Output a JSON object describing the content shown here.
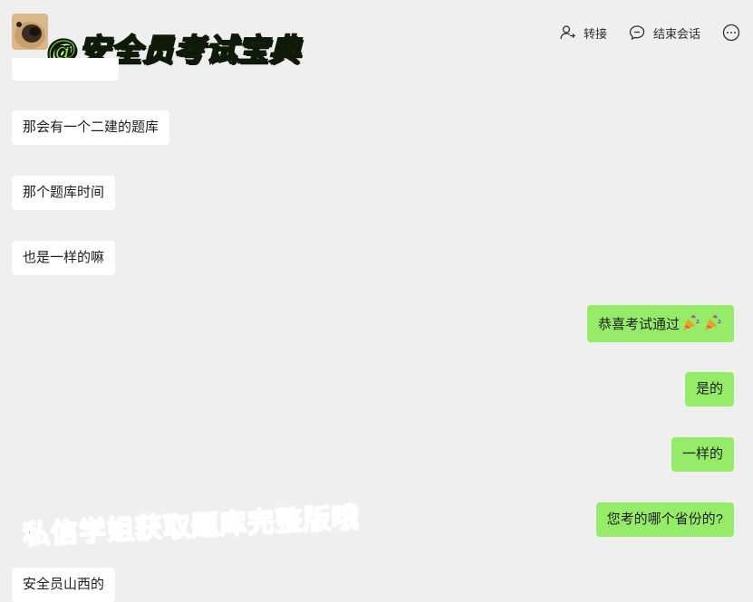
{
  "header": {
    "watermark_title": "@安全员考试宝典",
    "transfer_label": "转接",
    "end_session_label": "结束会话"
  },
  "messages": [
    {
      "side": "in",
      "text": "那会有一个二建的题库"
    },
    {
      "side": "in",
      "text": "那个题库时间"
    },
    {
      "side": "in",
      "text": "也是一样的嘛"
    },
    {
      "side": "out",
      "text": "恭喜考试通过",
      "emoji": "party-popper x2"
    },
    {
      "side": "out",
      "text": "是的"
    },
    {
      "side": "out",
      "text": "一样的"
    },
    {
      "side": "out",
      "text": "您考的哪个省份的?"
    },
    {
      "side": "in",
      "text": "安全员山西的"
    }
  ],
  "overlay": {
    "watermark_bottom": "私信学姐获取题库完整版哦"
  },
  "colors": {
    "background": "#efefef",
    "incoming_bubble": "#ffffff",
    "outgoing_bubble": "#95ec69",
    "watermark_green": "#7be62a",
    "watermark_blue": "#4aa8f0"
  }
}
